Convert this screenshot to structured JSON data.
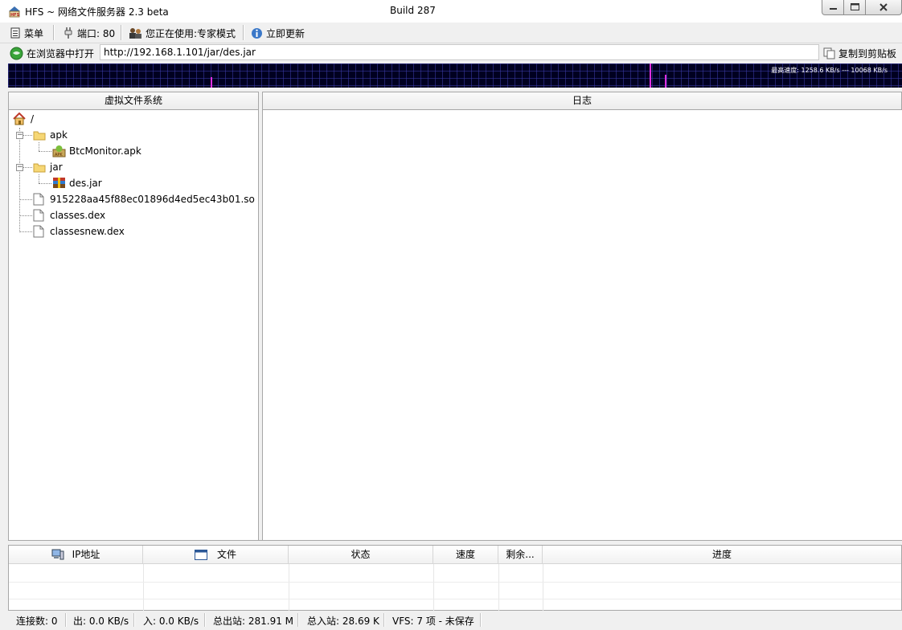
{
  "window": {
    "title": "HFS ~ 网络文件服务器 2.3 beta",
    "build": "Build 287"
  },
  "toolbar": {
    "menu": "菜单",
    "port": "端口: 80",
    "mode": "您正在使用:专家模式",
    "update": "立即更新"
  },
  "urlbar": {
    "open_in_browser": "在浏览器中打开",
    "url": "http://192.168.1.101/jar/des.jar",
    "copy_to_clipboard": "复制到剪贴板"
  },
  "graph": {
    "label": "最高速度: 1258.6 KB/s --- 10068 KB/s",
    "colors": {
      "background": "#000020",
      "grid": "#3c3caa",
      "spike": "#e030e0"
    }
  },
  "panes": {
    "vfs_title": "虚拟文件系统",
    "log_title": "日志"
  },
  "tree": {
    "root": "/",
    "items": [
      {
        "label": "apk",
        "type": "folder"
      },
      {
        "label": "BtcMonitor.apk",
        "type": "apk-file"
      },
      {
        "label": "jar",
        "type": "folder"
      },
      {
        "label": "des.jar",
        "type": "archive-file"
      },
      {
        "label": "915228aa45f88ec01896d4ed5ec43b01.so",
        "type": "file"
      },
      {
        "label": "classes.dex",
        "type": "file"
      },
      {
        "label": "classesnew.dex",
        "type": "file"
      }
    ]
  },
  "connections": {
    "columns": [
      "IP地址",
      "文件",
      "状态",
      "速度",
      "剩余...",
      "进度"
    ]
  },
  "status": {
    "connections": "连接数: 0",
    "out": "出: 0.0 KB/s",
    "in": "入: 0.0 KB/s",
    "total_out": "总出站: 281.91 M",
    "total_in": "总入站: 28.69 K",
    "vfs": "VFS: 7 项 - 未保存"
  }
}
